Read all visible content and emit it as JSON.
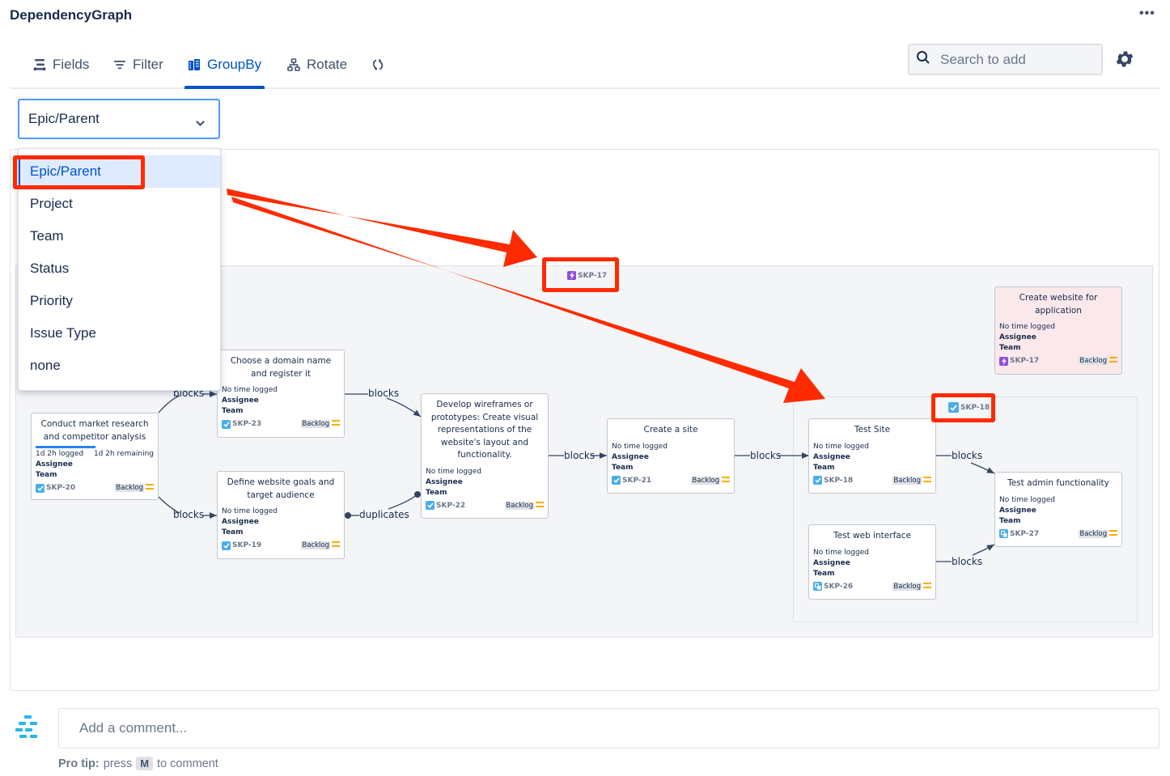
{
  "app": {
    "title": "DependencyGraph",
    "more_label": "•••"
  },
  "toolbar": {
    "tabs": [
      {
        "label": "Fields",
        "icon": "fields-icon"
      },
      {
        "label": "Filter",
        "icon": "filter-icon"
      },
      {
        "label": "GroupBy",
        "icon": "groupby-icon",
        "active": true
      },
      {
        "label": "Rotate",
        "icon": "hierarchy-icon"
      },
      {
        "label": "",
        "icon": "refresh-icon"
      }
    ],
    "search_placeholder": "Search to add",
    "settings_icon": "gear-icon"
  },
  "groupby": {
    "selected": "Epic/Parent",
    "options": [
      "Epic/Parent",
      "Project",
      "Team",
      "Status",
      "Priority",
      "Issue Type",
      "none"
    ]
  },
  "groups": {
    "outer": {
      "key": "SKP-17",
      "type": "epic"
    },
    "inner": {
      "key": "SKP-18",
      "type": "task"
    }
  },
  "cards": [
    {
      "id": "skp20",
      "title": "Conduct market research and competitor analysis",
      "time_logged": "1d 2h logged",
      "time_remaining": "1d 2h remaining",
      "progress": 0.5,
      "assignee_label": "Assignee",
      "team_label": "Team",
      "key": "SKP-20",
      "type": "task",
      "status": "Backlog"
    },
    {
      "id": "skp23",
      "title": "Choose a domain name and register it",
      "time": "No time logged",
      "assignee_label": "Assignee",
      "team_label": "Team",
      "key": "SKP-23",
      "type": "task",
      "status": "Backlog"
    },
    {
      "id": "skp19",
      "title": "Define website goals and target audience",
      "time": "No time logged",
      "assignee_label": "Assignee",
      "team_label": "Team",
      "key": "SKP-19",
      "type": "task",
      "status": "Backlog"
    },
    {
      "id": "skp22",
      "title": "Develop wireframes or prototypes: Create visual representations of the website's layout and functionality.",
      "time": "No time logged",
      "assignee_label": "Assignee",
      "team_label": "Team",
      "key": "SKP-22",
      "type": "task",
      "status": "Backlog"
    },
    {
      "id": "skp21",
      "title": "Create a site",
      "time": "No time logged",
      "assignee_label": "Assignee",
      "team_label": "Team",
      "key": "SKP-21",
      "type": "task",
      "status": "Backlog"
    },
    {
      "id": "skp18",
      "title": "Test Site",
      "time": "No time logged",
      "assignee_label": "Assignee",
      "team_label": "Team",
      "key": "SKP-18",
      "type": "task",
      "status": "Backlog"
    },
    {
      "id": "skp26",
      "title": "Test web interface",
      "time": "No time logged",
      "assignee_label": "Assignee",
      "team_label": "Team",
      "key": "SKP-26",
      "type": "subtask",
      "status": "Backlog"
    },
    {
      "id": "skp27",
      "title": "Test admin functionality",
      "time": "No time logged",
      "assignee_label": "Assignee",
      "team_label": "Team",
      "key": "SKP-27",
      "type": "subtask",
      "status": "Backlog"
    },
    {
      "id": "skp17",
      "title": "Create website for application",
      "time": "No time logged",
      "assignee_label": "Assignee",
      "team_label": "Team",
      "key": "SKP-17",
      "type": "epic",
      "status": "Backlog"
    }
  ],
  "edges": [
    {
      "from": "SKP-20",
      "to": "SKP-23",
      "label": "blocks"
    },
    {
      "from": "SKP-20",
      "to": "SKP-19",
      "label": "blocks"
    },
    {
      "from": "SKP-23",
      "to": "SKP-22",
      "label": "blocks"
    },
    {
      "from": "SKP-19",
      "to": "SKP-22",
      "label": "duplicates"
    },
    {
      "from": "SKP-22",
      "to": "SKP-21",
      "label": "blocks"
    },
    {
      "from": "SKP-21",
      "to": "SKP-18",
      "label": "blocks"
    },
    {
      "from": "SKP-18",
      "to": "SKP-27",
      "label": "blocks"
    },
    {
      "from": "SKP-26",
      "to": "SKP-27",
      "label": "blocks"
    }
  ],
  "annotation": {
    "color": "#ff2a00",
    "highlighted": [
      "Epic/Parent",
      "SKP-17",
      "SKP-18"
    ]
  },
  "comment": {
    "placeholder": "Add a comment...",
    "protip_label": "Pro tip:",
    "protip_pre": "press",
    "protip_key": "M",
    "protip_post": "to comment"
  },
  "colors": {
    "accent": "#0052cc",
    "task": "#4bade8",
    "epic": "#904ee2",
    "status_medium": "#ffab00"
  }
}
